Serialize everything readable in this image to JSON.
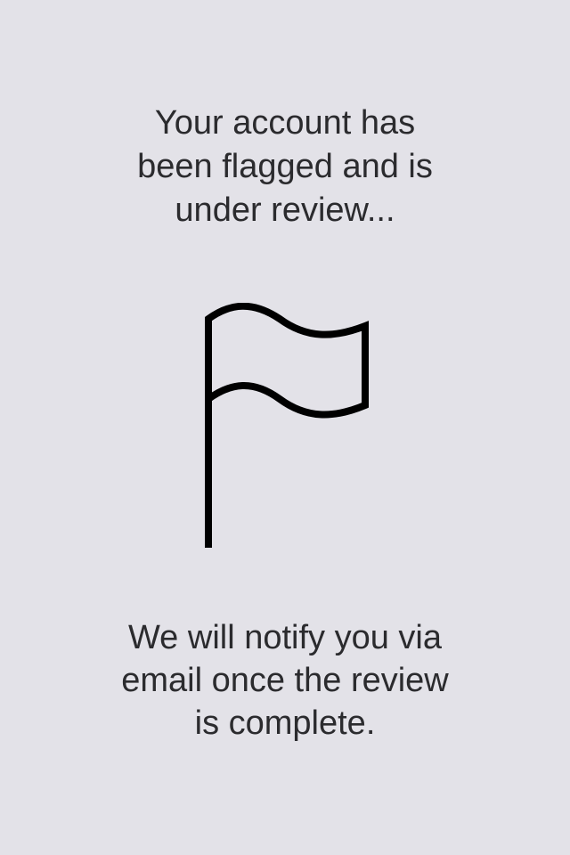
{
  "review_screen": {
    "heading_lines": [
      "Your account has",
      "been flagged and is",
      "under review..."
    ],
    "icon": "flag-icon",
    "message_lines": [
      "We will notify you via",
      "email once the review",
      "is complete."
    ]
  },
  "colors": {
    "background": "#e3e2e8",
    "text": "#2b2b2e",
    "icon_stroke": "#000000"
  }
}
